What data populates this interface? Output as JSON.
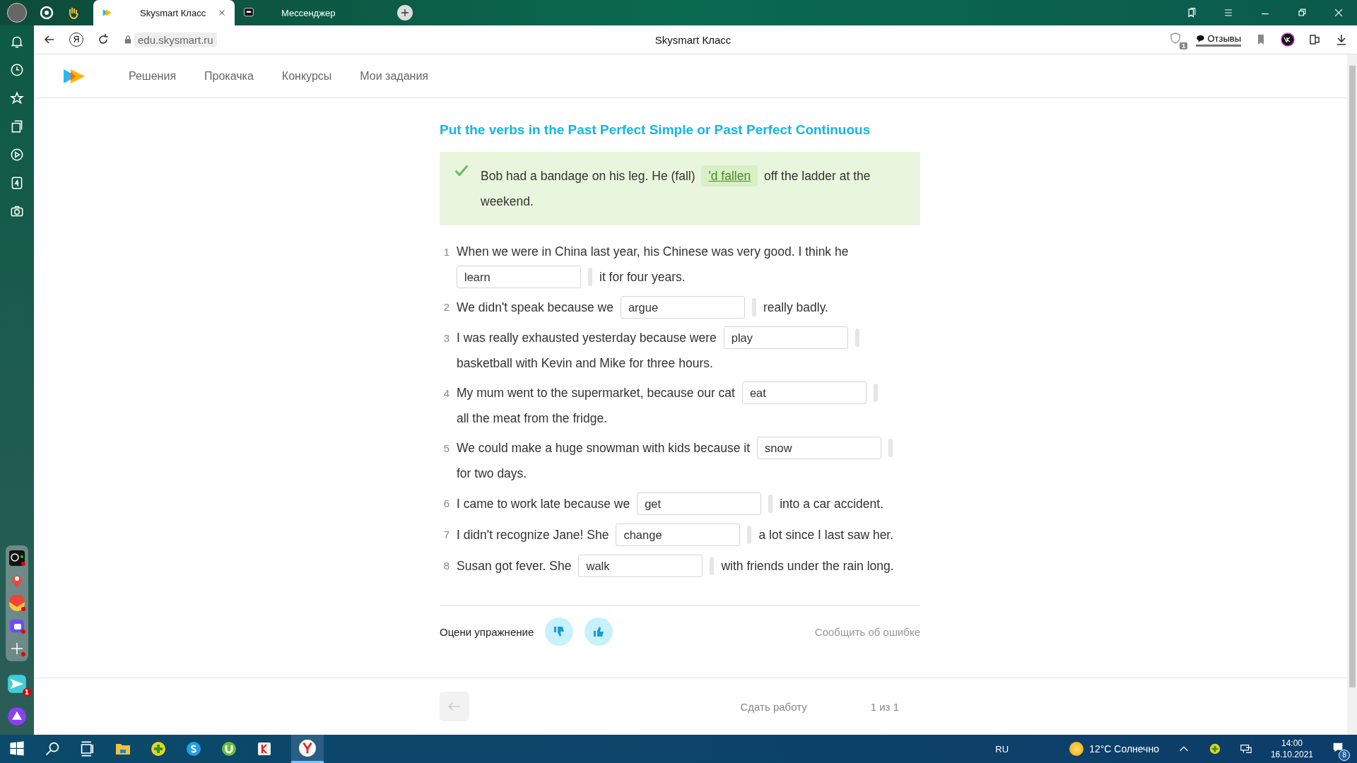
{
  "browser": {
    "tabs": [
      {
        "title": "Skysmart Класс",
        "selected": true,
        "kind": "skysmart"
      },
      {
        "title": "Мессенджер",
        "selected": false,
        "kind": "messenger"
      }
    ],
    "logo_button": "Я",
    "address": "edu.skysmart.ru",
    "page_title": "Skysmart Класс",
    "reviews_button": "Отзывы",
    "protect_badge": "1"
  },
  "sidebar": {
    "messenger_badge": "1"
  },
  "site_nav": {
    "items": [
      "Решения",
      "Прокачка",
      "Конкурсы",
      "Мои задания"
    ]
  },
  "exercise": {
    "title": "Put the verbs in the Past Perfect Simple or Past Perfect Continuous",
    "example": {
      "correct": true,
      "before": "Bob had a bandage on his leg. He (fall)",
      "answer": "'d fallen",
      "after": "off the ladder at the weekend."
    },
    "questions": [
      {
        "number": "1",
        "before": "When we were in China last year, his Chinese was very good. I think he",
        "placeholder": "learn",
        "after": "it for four years."
      },
      {
        "number": "2",
        "before": "We didn't speak because we",
        "placeholder": "argue",
        "after": "really badly."
      },
      {
        "number": "3",
        "before": "I was really exhausted yesterday because were",
        "placeholder": "play",
        "after": "basketball with Kevin and Mike for three hours."
      },
      {
        "number": "4",
        "before": "My mum went to the supermarket, because our cat",
        "placeholder": "eat",
        "after": "all the meat from the fridge."
      },
      {
        "number": "5",
        "before": "We could make a huge snowman with kids because it",
        "placeholder": "snow",
        "after": "for two days."
      },
      {
        "number": "6",
        "before": "I came to work late because we",
        "placeholder": "get",
        "after": "into a car accident."
      },
      {
        "number": "7",
        "before": "I didn't recognize Jane! She",
        "placeholder": "change",
        "after": "a lot since I last saw her."
      },
      {
        "number": "8",
        "before": "Susan got fever. She",
        "placeholder": "walk",
        "after": "with friends under the rain long."
      }
    ],
    "rate_label": "Оцени упражнение",
    "report_link": "Сообщить об ошибке"
  },
  "footer": {
    "submit": "Сдать работу",
    "pages": "1 из 1"
  },
  "taskbar": {
    "language": "RU",
    "weather": "12°C  Солнечно",
    "time": "14:00",
    "date": "16.10.2021",
    "notifications": "8"
  }
}
